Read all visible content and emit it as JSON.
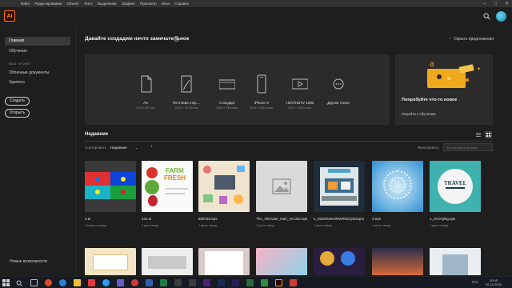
{
  "app": {
    "logo_text": "Ai",
    "brand_color": "#ff9a00",
    "menu": [
      "Файл",
      "Редактирование",
      "Объект",
      "Текст",
      "Выделение",
      "Эффект",
      "Просмотр",
      "Окно",
      "Справка"
    ]
  },
  "sidebar": {
    "items": [
      {
        "label": "Главная",
        "active": true
      },
      {
        "label": "Обучение",
        "active": false
      }
    ],
    "section_heading": "ВАШ ПРОЕКТ",
    "project_items": [
      "Облачные документы",
      "Удалено"
    ],
    "create_button": "Создать",
    "open_button": "Открыть",
    "whats_new": "Новые возможности"
  },
  "welcome": {
    "title": "Давайте создадим нечто замечательное",
    "info_icon": "i",
    "hide_suggestions": "Скрыть предложения"
  },
  "presets": [
    {
      "name": "A4",
      "size": "210 x 297 мм",
      "icon": "document-icon"
    },
    {
      "name": "Почтовая откр…",
      "size": "3050 x 39750 мм",
      "icon": "postcard-icon"
    },
    {
      "name": "Стандарт",
      "size": "1366 x 768 пикс.",
      "icon": "monitor-icon"
    },
    {
      "name": "iPhone X",
      "size": "1125 x 2436 пикс.",
      "icon": "phone-icon"
    },
    {
      "name": "HDV/HDTV 1080",
      "size": "1920 x 1080 пикс.",
      "icon": "video-icon"
    },
    {
      "name": "Другие стили",
      "size": "",
      "icon": "more-icon"
    }
  ],
  "try_panel": {
    "title": "Попробуйте что-то новое",
    "link": "Перейти к обучению"
  },
  "recent": {
    "title": "Недавние",
    "sort_label": "Сортировать",
    "sort_value": "Недавние",
    "filter_label": "Фильтровать",
    "filter_placeholder": "Фильтровать файлы"
  },
  "files": [
    {
      "name": "4.ai",
      "date": "1 минута назад"
    },
    {
      "name": "441.ai",
      "date": "4 дня назад"
    },
    {
      "name": "606753.eps",
      "date": "1 день назад"
    },
    {
      "name": "The_Vitruvian_man_InColor.eps",
      "date": "1 день назад"
    },
    {
      "name": "2_MzE5NWViNWRkGQ4bSqrG…",
      "date": "1 день назад"
    },
    {
      "name": "2.eps",
      "date": "1 день назад"
    },
    {
      "name": "1_ZmVQNg.eps",
      "date": "1 день назад"
    }
  ],
  "taskbar": {
    "lang": "РУС",
    "time": "20:05",
    "date": "05.10.2020"
  }
}
